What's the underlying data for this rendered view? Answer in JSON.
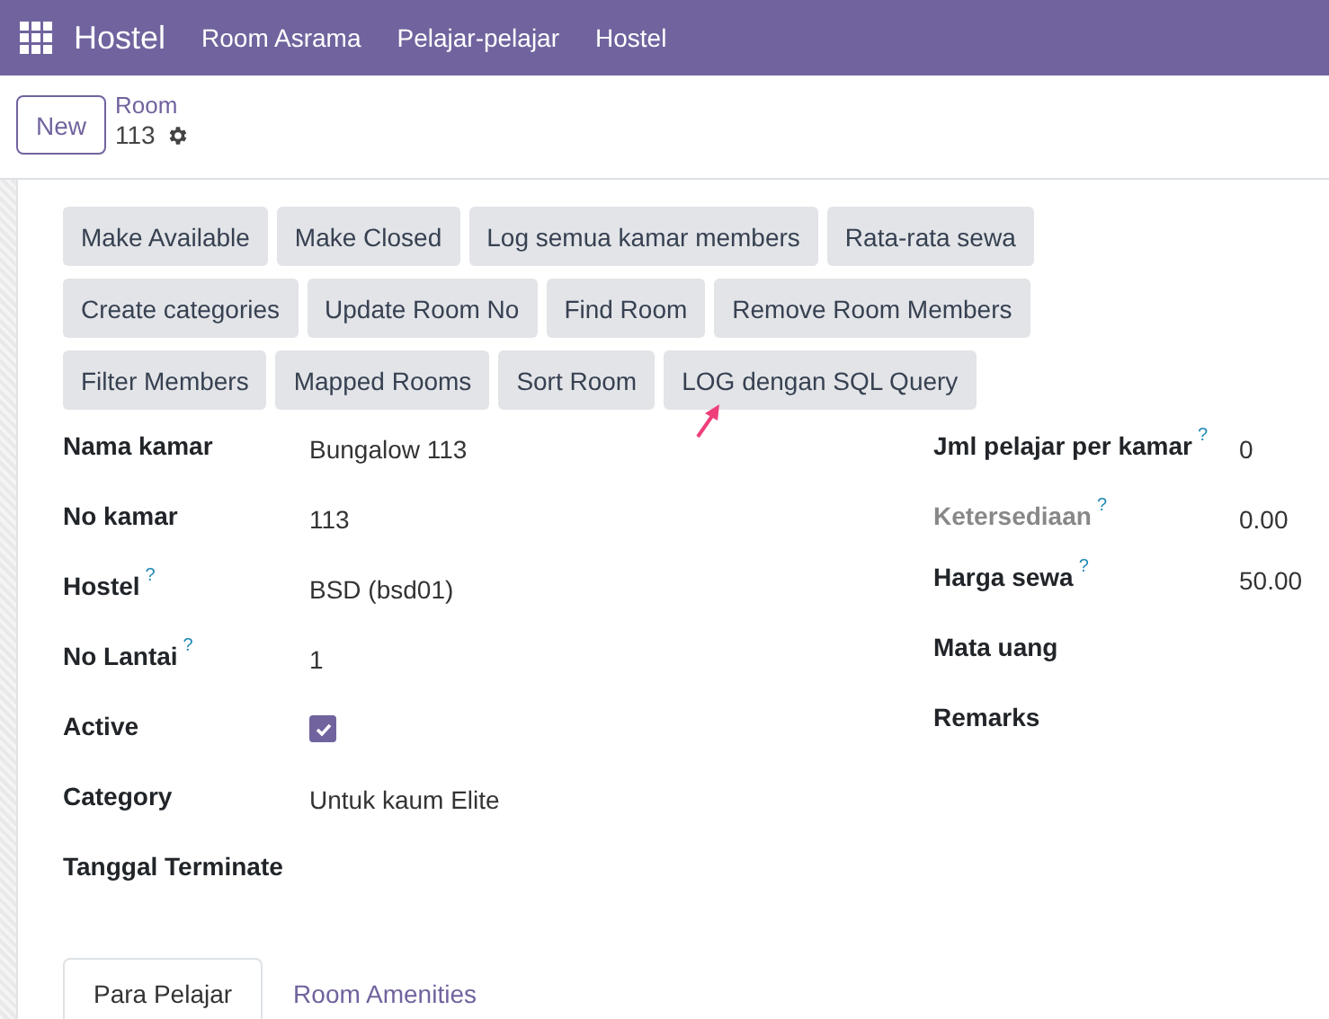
{
  "navbar": {
    "app": "Hostel",
    "menu": [
      "Room Asrama",
      "Pelajar-pelajar",
      "Hostel"
    ]
  },
  "control_panel": {
    "new_button": "New",
    "breadcrumb": "Room",
    "record": "113"
  },
  "action_buttons": [
    [
      "Make Available",
      "Make Closed",
      "Log semua kamar members",
      "Rata-rata sewa"
    ],
    [
      "Create categories",
      "Update Room No",
      "Find Room",
      "Remove Room Members"
    ],
    [
      "Filter Members",
      "Mapped Rooms",
      "Sort Room",
      "LOG dengan SQL Query"
    ]
  ],
  "left_fields": [
    {
      "label": "Nama kamar",
      "kind": "text",
      "value": "Bungalow 113"
    },
    {
      "label": "No kamar",
      "kind": "text",
      "value": "113"
    },
    {
      "label": "Hostel",
      "help": "?",
      "kind": "text",
      "value": "BSD (bsd01)"
    },
    {
      "label": "No Lantai",
      "help": "?",
      "kind": "text",
      "value": "1"
    },
    {
      "label": "Active",
      "kind": "checkbox",
      "checked": true
    },
    {
      "label": "Category",
      "kind": "text",
      "value": "Untuk kaum Elite"
    },
    {
      "label": "Tanggal Terminate",
      "kind": "text"
    }
  ],
  "right_fields": [
    {
      "label": "Jml pelajar per kamar",
      "help": "?",
      "value": "0",
      "disabled": false
    },
    {
      "label": "Ketersediaan",
      "help": "?",
      "value": "0.00",
      "disabled": true
    },
    {
      "label": "Harga sewa",
      "help": "?",
      "value": "50.00",
      "disabled": false
    },
    {
      "label": "Mata uang",
      "disabled": false
    },
    {
      "label": "Remarks",
      "disabled": false
    }
  ],
  "tabs": [
    {
      "label": "Para Pelajar",
      "selected": true
    },
    {
      "label": "Room Amenities",
      "selected": false
    }
  ]
}
